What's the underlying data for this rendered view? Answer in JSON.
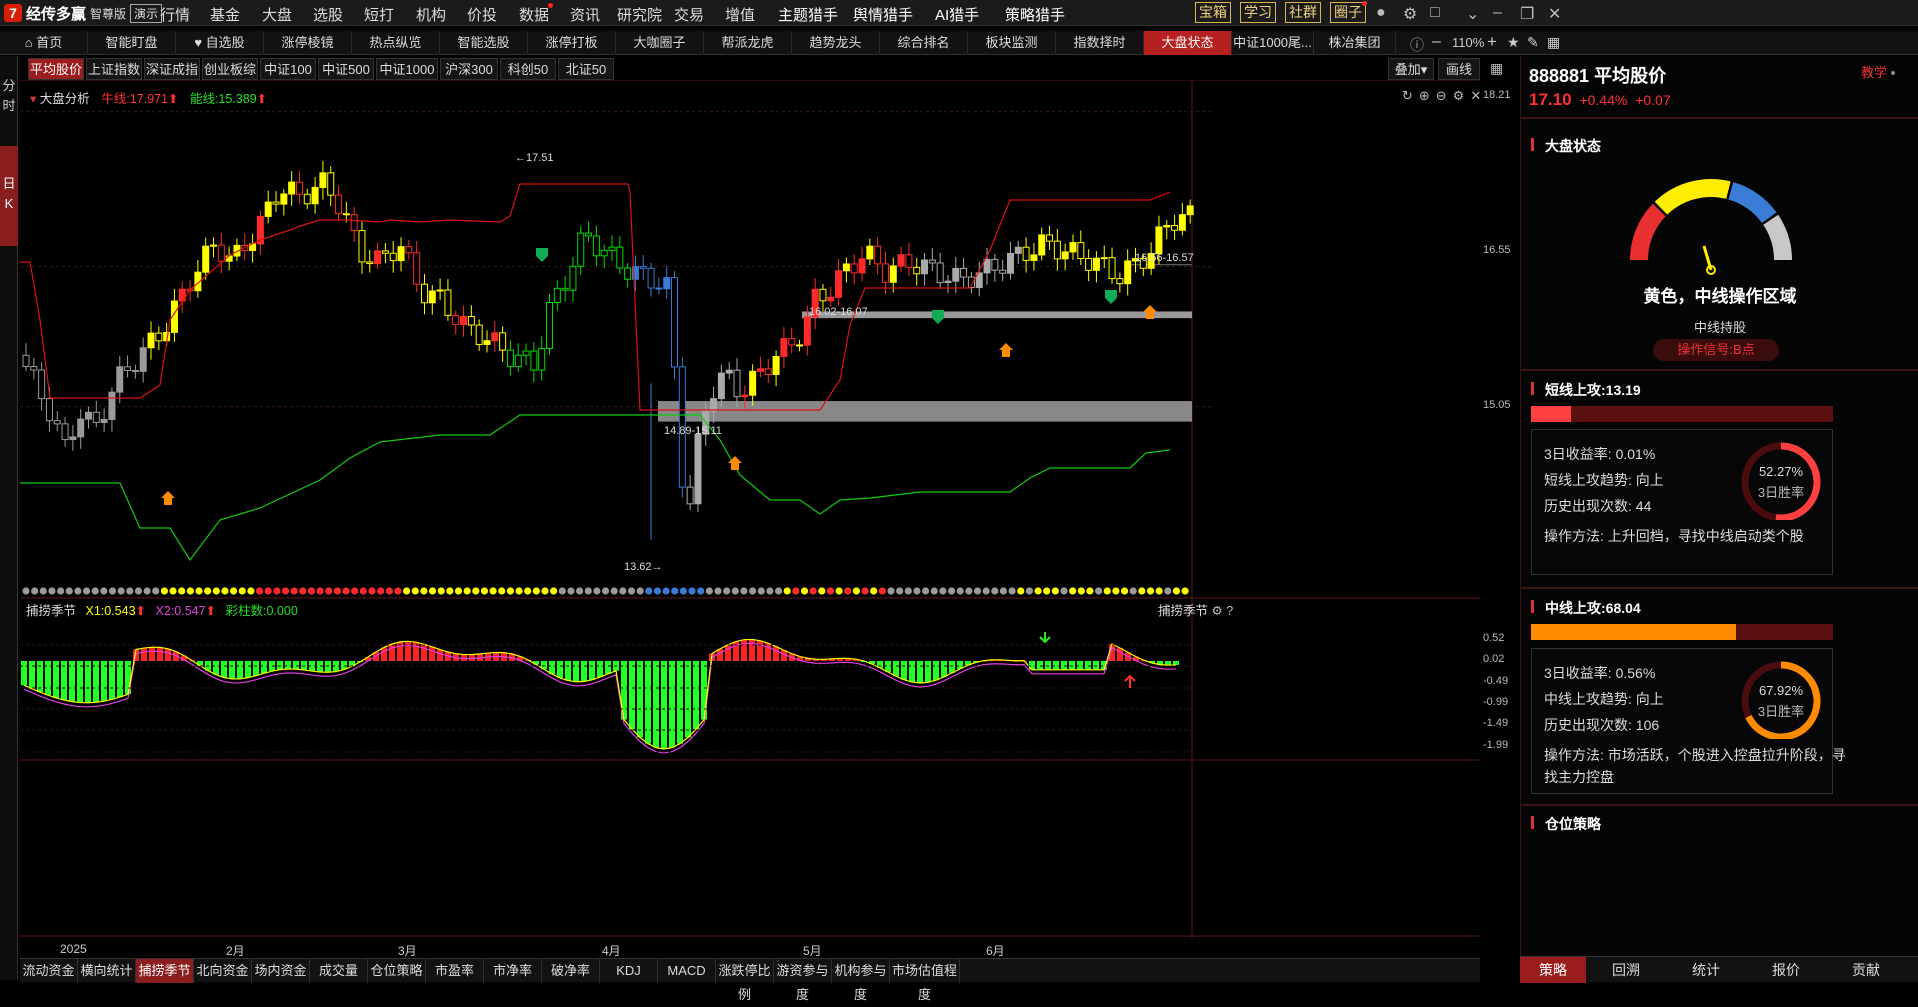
{
  "app": {
    "logo_text": "经传多赢",
    "edition": "智尊版",
    "demo": "演示",
    "menu": [
      "行情",
      "基金",
      "大盘",
      "选股",
      "短打",
      "机构",
      "价投",
      "数据",
      "资讯",
      "研究院",
      "交易",
      "增值"
    ],
    "hunters": [
      "主题猎手",
      "舆情猎手",
      "AI猎手",
      "策略猎手"
    ],
    "tools": [
      "宝箱",
      "学习",
      "社群",
      "圈子"
    ]
  },
  "tabs": {
    "items": [
      "首页",
      "智能盯盘",
      "自选股",
      "涨停棱镜",
      "热点纵览",
      "智能选股",
      "涨停打板",
      "大咖圈子",
      "帮派龙虎",
      "趋势龙头",
      "综合排名",
      "板块监测",
      "指数择时",
      "大盘状态",
      "中证1000尾...",
      "株冶集团"
    ],
    "zoom": "110%"
  },
  "leftstrip": {
    "fen": "分",
    "shi": "时",
    "ri": "日",
    "k": "K"
  },
  "subtabs": {
    "items": [
      "平均股价",
      "上证指数",
      "深证成指",
      "创业板综",
      "中证100",
      "中证500",
      "中证1000",
      "沪深300",
      "科创50",
      "北证50"
    ],
    "overlay": "叠加",
    "draw": "画线"
  },
  "main_chart": {
    "indicator_name": "大盘分析",
    "niu_label": "牛线:17.971",
    "neng_label": "能线:15.389",
    "price_ticks": [
      "18.21",
      "16.55",
      "15.05"
    ],
    "annotations": {
      "high": "17.51",
      "low": "13.62",
      "zone_low": "14.89-15.11",
      "zone_mid": "16.02-16.07",
      "zone_top": "16.56-16.57"
    }
  },
  "sub_chart": {
    "name": "捕捞季节",
    "x1": "X1:0.543",
    "x2": "X2:0.547",
    "bars": "彩柱数:0.000",
    "title_right": "捕捞季节",
    "ticks": [
      "0.52",
      "0.02",
      "-0.49",
      "-0.99",
      "-1.49",
      "-1.99"
    ]
  },
  "dates": [
    "2025",
    "2月",
    "3月",
    "4月",
    "5月",
    "6月"
  ],
  "bottom_tabs": [
    "流动资金",
    "横向统计",
    "捕捞季节",
    "北向资金",
    "场内资金",
    "成交量",
    "仓位策略",
    "市盈率",
    "市净率",
    "破净率",
    "KDJ",
    "MACD",
    "涨跌停比例",
    "游资参与度",
    "机构参与度",
    "市场估值程度"
  ],
  "right_panel": {
    "code_name": "888881 平均股价",
    "teach": "教学",
    "price": "17.10",
    "change_pct": "+0.44%",
    "change": "+0.07",
    "market_state_title": "大盘状态",
    "state_text": "黄色，中线操作区域",
    "state_sub": "中线持股",
    "signal": "操作信号:B点",
    "short": {
      "title": "短线上攻:13.19",
      "level": 13.19,
      "ret_label": "3日收益率: 0.01%",
      "trend_label": "短线上攻趋势: 向上",
      "count_label": "历史出现次数: 44",
      "method": "操作方法: 上升回档，寻找中线启动类个股",
      "winrate": "52.27%",
      "winrate_value": 52.27,
      "win_label": "3日胜率"
    },
    "mid": {
      "title": "中线上攻:68.04",
      "level": 68.04,
      "ret_label": "3日收益率: 0.56%",
      "trend_label": "中线上攻趋势: 向上",
      "count_label": "历史出现次数: 106",
      "method1": "操作方法: 市场活跃，个股进入控盘拉升阶段，寻",
      "method2": "找主力控盘",
      "winrate": "67.92%",
      "winrate_value": 67.92,
      "win_label": "3日胜率"
    },
    "position_title": "仓位策略",
    "bottom_tabs": [
      "策略",
      "回溯",
      "统计",
      "报价",
      "贡献"
    ]
  },
  "colors": {
    "up": "#ff2a2a",
    "yellow": "#ffff00",
    "green": "#00ff00",
    "blue": "#3a7bd5",
    "gray": "#888888"
  }
}
